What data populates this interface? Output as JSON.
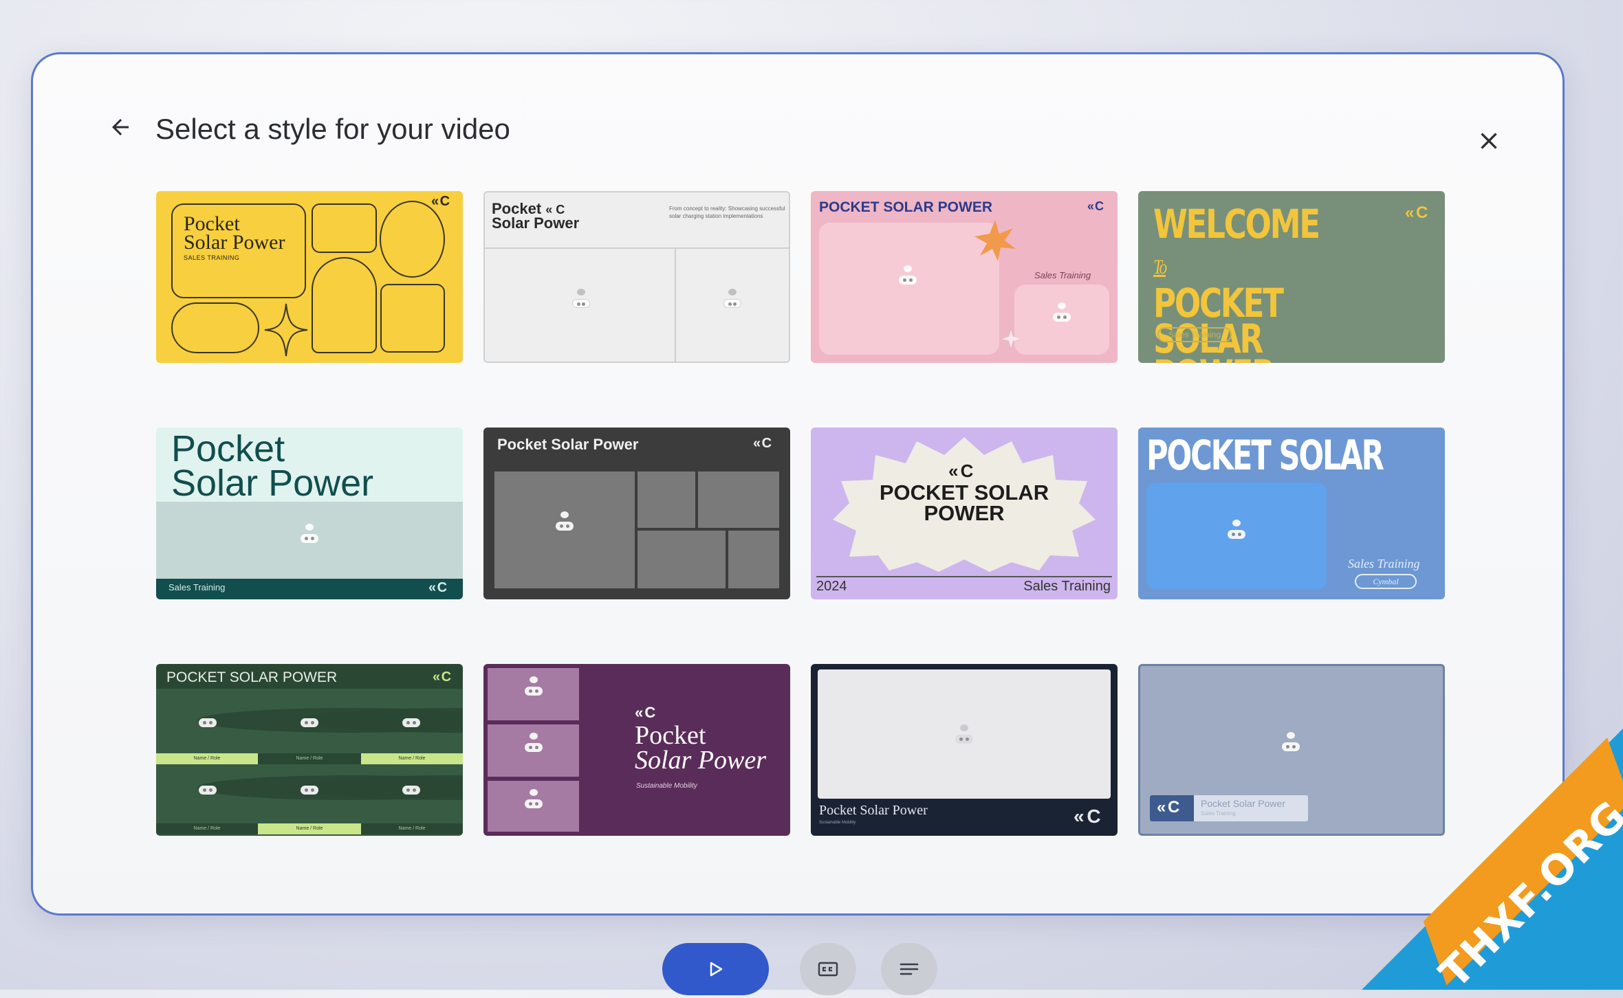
{
  "dialog": {
    "title": "Select a style for your video",
    "back_icon": "arrow-left-icon",
    "close_icon": "close-icon"
  },
  "logo_text": "« C",
  "styles": [
    {
      "title_line1": "Pocket",
      "title_line2": "Solar Power",
      "subtitle": "SALES TRAINING"
    },
    {
      "title_line1": "Pocket",
      "title_line2": "Solar Power",
      "subtitle": "From concept to reality: Showcasing successful solar charging station implementations"
    },
    {
      "title": "POCKET SOLAR POWER",
      "subtitle": "Sales Training"
    },
    {
      "title_line1": "WELCOME",
      "title_to": "To",
      "title_line2": "POCKET SOLAR",
      "title_line3": "POWER",
      "subtitle": "Sales Training"
    },
    {
      "title_line1": "Pocket",
      "title_line2": "Solar Power",
      "subtitle": "Sales Training"
    },
    {
      "title": "Pocket Solar Power"
    },
    {
      "title_line1": "POCKET SOLAR",
      "title_line2": "POWER",
      "year": "2024",
      "subtitle": "Sales Training"
    },
    {
      "title": "POCKET SOLAR POWER",
      "subtitle": "Sales Training",
      "pill": "Cymbal"
    },
    {
      "title": "POCKET SOLAR POWER",
      "label": "Name / Role"
    },
    {
      "title_line1": "Pocket",
      "title_line2": "Solar Power",
      "subtitle": "Sustainable Mobility"
    },
    {
      "title": "Pocket Solar Power",
      "subtitle": "Sustainable Mobility"
    },
    {
      "title": "Pocket Solar Power",
      "subtitle": "Sales Training"
    }
  ],
  "controls": {
    "play_icon": "play-icon",
    "captions_icon": "closed-captions-icon",
    "transcript_icon": "transcript-icon"
  },
  "watermark": "THXF.ORG",
  "colors": {
    "accent_blue": "#3159cc",
    "dialog_border": "#5b78cf"
  }
}
